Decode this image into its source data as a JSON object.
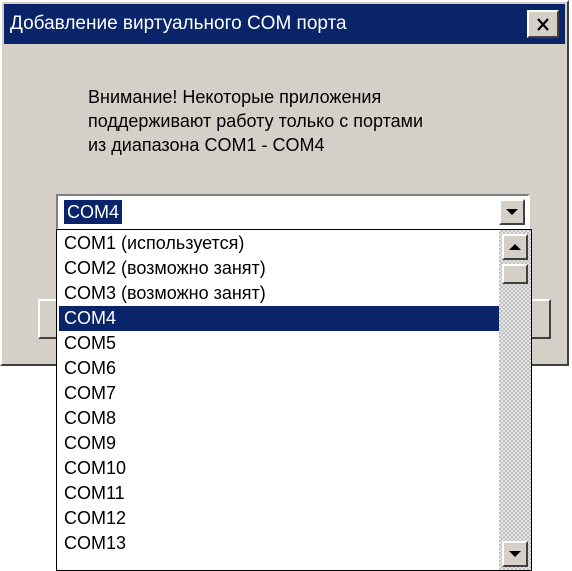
{
  "window": {
    "title": "Добавление виртуального COM порта",
    "close_icon": "close-icon"
  },
  "message": {
    "lines": [
      "Внимание! Некоторые приложения",
      "поддерживают работу только с портами",
      "из диапазона COM1 - COM4"
    ]
  },
  "combo": {
    "selected": "COM4",
    "arrow_icon": "chevron-down-icon"
  },
  "dropdown": {
    "items": [
      "COM1 (используется)",
      "COM2 (возможно занят)",
      "COM3 (возможно занят)",
      "COM4",
      "COM5",
      "COM6",
      "COM7",
      "COM8",
      "COM9",
      "COM10",
      "COM11",
      "COM12",
      "COM13"
    ],
    "selected_index": 3
  },
  "colors": {
    "title_bar": "#0a246a",
    "selection": "#0a246a",
    "face": "#d4d0c8"
  }
}
